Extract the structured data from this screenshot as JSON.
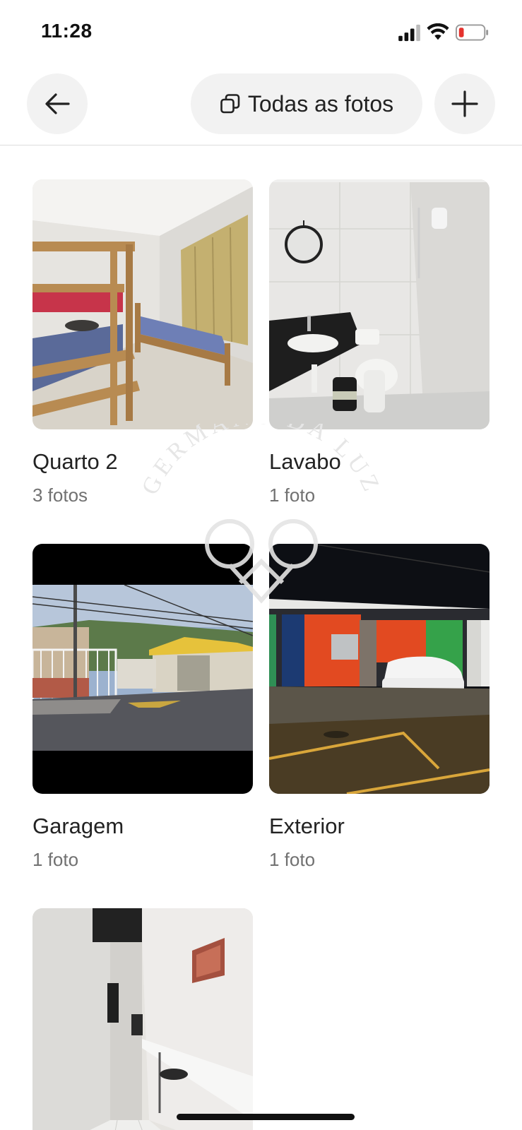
{
  "status_bar": {
    "time": "11:28"
  },
  "header": {
    "back_icon": "arrow-left-icon",
    "all_photos_label": "Todas as fotos",
    "all_photos_icon": "copy-stack-icon",
    "add_icon": "plus-icon"
  },
  "rooms": [
    {
      "name": "Quarto 2",
      "count": "3 fotos",
      "photo": "bunk-bed-bedroom"
    },
    {
      "name": "Lavabo",
      "count": "1 foto",
      "photo": "bathroom"
    },
    {
      "name": "Garagem",
      "count": "1 foto",
      "photo": "street-view"
    },
    {
      "name": "Exterior",
      "count": "1 foto",
      "photo": "house-exterior-night"
    },
    {
      "photo": "hallway-with-desk"
    }
  ],
  "watermark": {
    "text": "GERMANO DA LUZ"
  },
  "colors": {
    "background": "#ffffff",
    "button_bg": "#f2f2f2",
    "text": "#222222",
    "secondary_text": "#717171",
    "battery_low": "#e5322d"
  }
}
